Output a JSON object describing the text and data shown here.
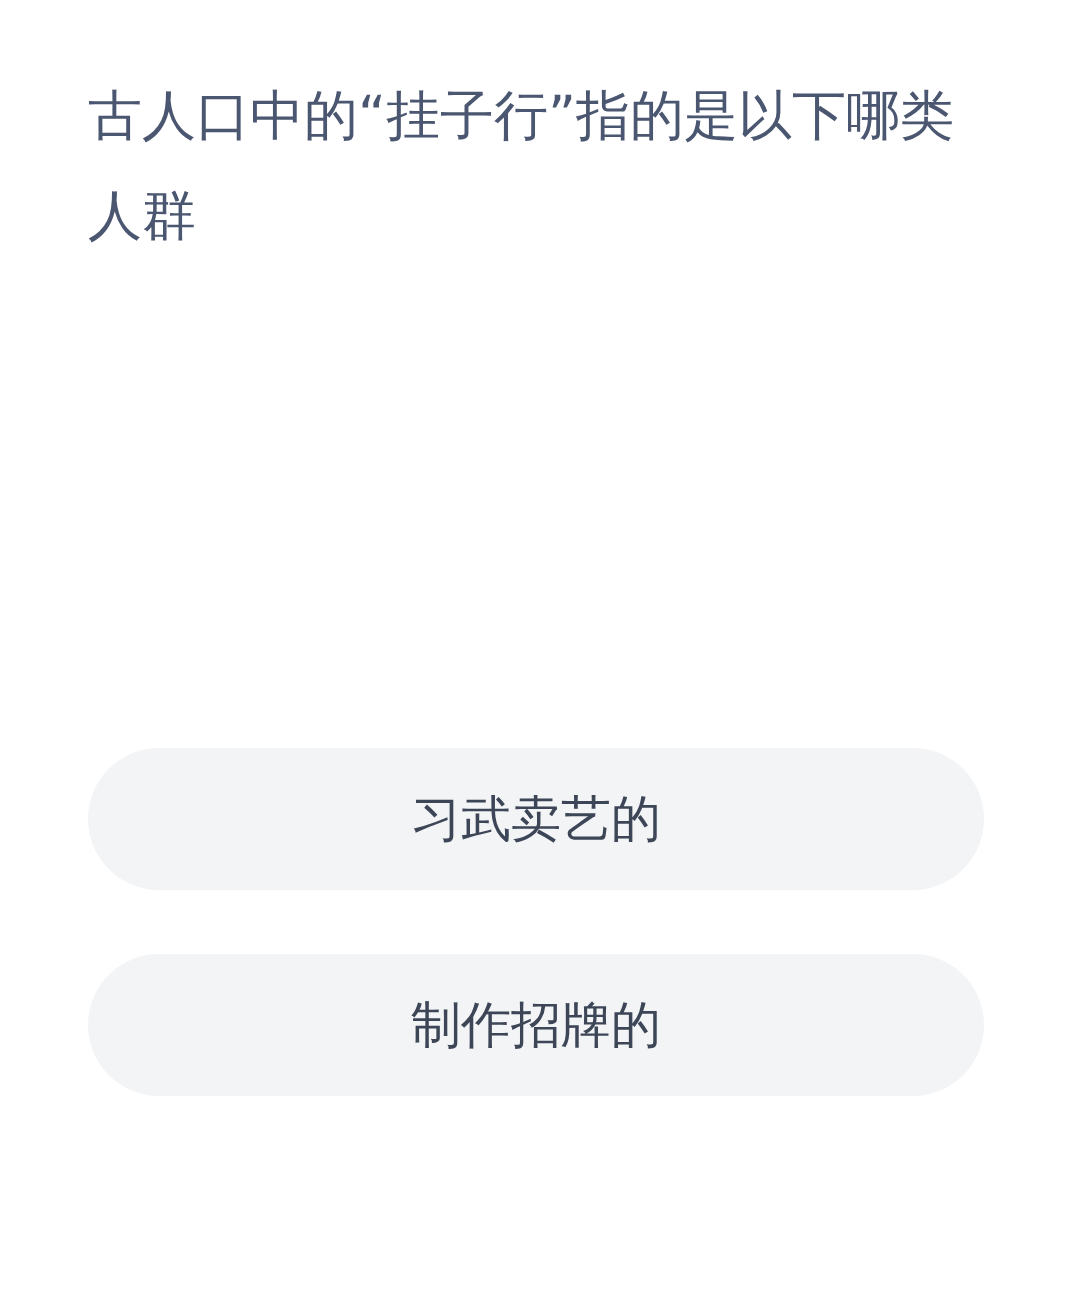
{
  "question": "古人口中的“挂子行”指的是以下哪类人群",
  "options": [
    {
      "label": "习武卖艺的"
    },
    {
      "label": "制作招牌的"
    }
  ]
}
